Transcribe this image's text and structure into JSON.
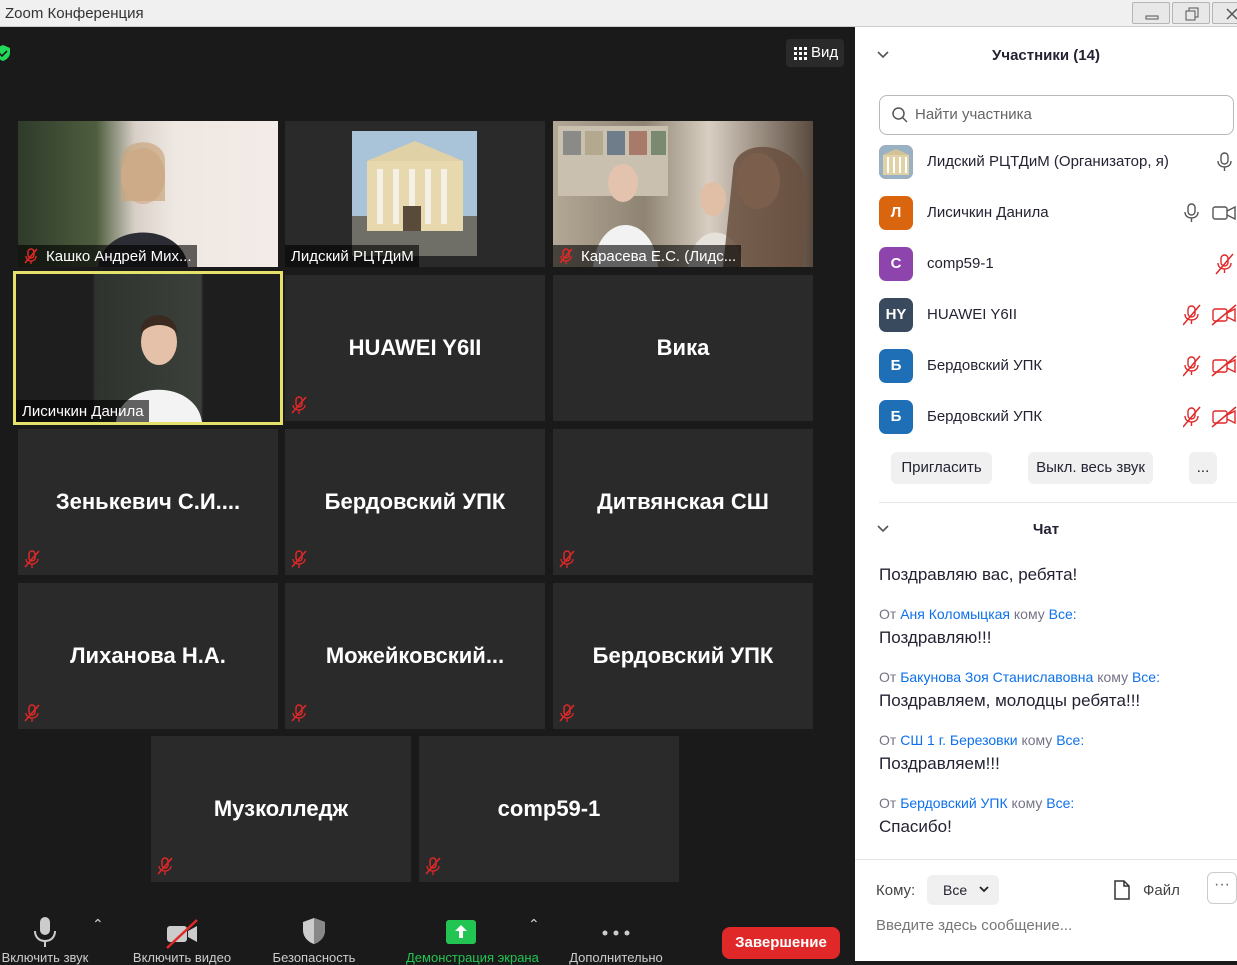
{
  "window": {
    "title": "Zoom Конференция"
  },
  "view_button": {
    "label": "Вид"
  },
  "tiles": [
    {
      "name": "Кашко Андрей Мих...",
      "muted": true,
      "video": true
    },
    {
      "name": "Лидский РЦТДиМ",
      "muted": false,
      "video": true
    },
    {
      "name": "Карасева Е.С. (Лидс...",
      "muted": true,
      "video": true
    },
    {
      "name": "Лисичкин Данила",
      "muted": false,
      "video": true,
      "active": true
    },
    {
      "name": "HUAWEI Y6II",
      "muted": true
    },
    {
      "name": "Вика",
      "muted": false
    },
    {
      "name": "Зенькевич  С.И....",
      "muted": true
    },
    {
      "name": "Бердовский УПК",
      "muted": true
    },
    {
      "name": "Дитвянская СШ",
      "muted": true
    },
    {
      "name": "Лиханова Н.А.",
      "muted": true
    },
    {
      "name": "Можейковский...",
      "muted": true
    },
    {
      "name": "Бердовский УПК",
      "muted": true
    },
    {
      "name": "Музколледж",
      "muted": true
    },
    {
      "name": "comp59-1",
      "muted": true
    }
  ],
  "toolbar": {
    "audio": "Включить звук",
    "video": "Включить видео",
    "security": "Безопасность",
    "share": "Демонстрация экрана",
    "more": "Дополнительно",
    "end": "Завершение"
  },
  "participants_panel": {
    "title": "Участники (14)",
    "search_placeholder": "Найти участника",
    "items": [
      {
        "name": "Лидский РЦТДиМ (Организатор, я)",
        "avatar": "",
        "color": "#8a7a5a"
      },
      {
        "name": "Лисичкин Данила",
        "avatar": "Л",
        "color": "#d9660f"
      },
      {
        "name": "comp59-1",
        "avatar": "C",
        "color": "#8e44ad"
      },
      {
        "name": "HUAWEI Y6II",
        "avatar": "HY",
        "color": "#3a4a5e"
      },
      {
        "name": "Бердовский УПК",
        "avatar": "Б",
        "color": "#1e6fb5"
      },
      {
        "name": "Бердовский УПК",
        "avatar": "Б",
        "color": "#1e6fb5"
      }
    ],
    "invite": "Пригласить",
    "mute_all": "Выкл. весь звук",
    "more": "..."
  },
  "chat": {
    "title": "Чат",
    "messages": [
      {
        "body": "Поздравляю вас, ребята!"
      },
      {
        "from_prefix": "От",
        "from": "Аня Коломыцкая",
        "to_prefix": "кому",
        "to": "Все:",
        "body": "Поздравляю!!!"
      },
      {
        "from_prefix": "От",
        "from": "Бакунова Зоя Станиславовна",
        "to_prefix": "кому",
        "to": "Все:",
        "body": "Поздравляем, молодцы ребята!!!"
      },
      {
        "from_prefix": "От",
        "from": "СШ 1 г. Березовки",
        "to_prefix": "кому",
        "to": "Все:",
        "body": "Поздравляем!!!"
      },
      {
        "from_prefix": "От",
        "from": "Бердовский УПК",
        "to_prefix": "кому",
        "to": "Все:",
        "body": "Спасибо!"
      }
    ],
    "to_label": "Кому:",
    "to_value": "Все",
    "file_label": "Файл",
    "more": "···",
    "input_placeholder": "Введите здесь сообщение..."
  }
}
